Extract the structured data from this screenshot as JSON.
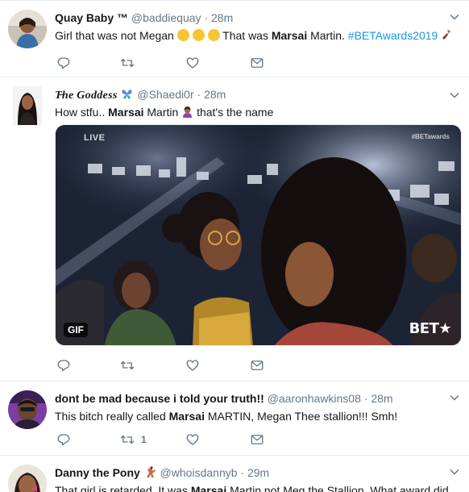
{
  "tweets": [
    {
      "name": "Quay Baby ™",
      "handle": "@baddiequay",
      "separator": "·",
      "time": "28m",
      "text_parts": [
        "Girl that was not Megan ",
        " That was ",
        "Marsai",
        " Martin. ",
        "#BETAwards2019",
        " "
      ],
      "reply_count": "",
      "retweet_count": "",
      "like_count": ""
    },
    {
      "name": "T̶he Goddess",
      "handle": "@Shaedi0r",
      "separator": "·",
      "time": "28m",
      "text_parts": [
        "How stfu.. ",
        "Marsai",
        " Martin ",
        " that's the name"
      ],
      "media": {
        "badge": "GIF",
        "live_tag": "LIVE",
        "corner_tag": "#BETawards",
        "logo": "BET★"
      },
      "reply_count": "",
      "retweet_count": "",
      "like_count": ""
    },
    {
      "name": "dont be mad because i told your truth!!",
      "handle": "@aaronhawkins08",
      "separator": "·",
      "time": "28m",
      "text_parts": [
        "This bitch really called ",
        "Marsai",
        " MARTIN,  Megan Thee stallion!!! Smh!"
      ],
      "reply_count": "",
      "retweet_count": "1",
      "like_count": ""
    },
    {
      "name": "Danny the Pony",
      "handle": "@whoisdannyb",
      "separator": "·",
      "time": "29m",
      "text_parts": [
        "That girl is retarded. It was ",
        "Marsai",
        " Martin not Meg the Stallion. What award did"
      ]
    }
  ],
  "colors": {
    "text": "#14171a",
    "secondary": "#657786",
    "hashtag": "#1b95e0",
    "border": "#e6ecf0"
  },
  "icons": [
    "reply-icon",
    "retweet-icon",
    "like-icon",
    "message-icon",
    "chevron-down-icon",
    "butterfly-emoji",
    "laughing-emoji",
    "bottle-emoji",
    "woman-emoji",
    "dancer-emoji"
  ]
}
